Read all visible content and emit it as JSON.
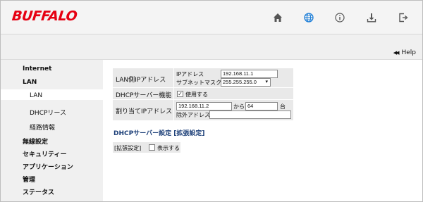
{
  "brand": {
    "logo": "BUFFALO",
    "color": "#e60012"
  },
  "header_icons": [
    {
      "name": "home-icon"
    },
    {
      "name": "globe-icon"
    },
    {
      "name": "info-icon"
    },
    {
      "name": "download-icon"
    },
    {
      "name": "logout-icon"
    }
  ],
  "help": {
    "label": "Help"
  },
  "sidebar": {
    "items": [
      {
        "label": "Internet",
        "level": 1
      },
      {
        "label": "LAN",
        "level": 1
      },
      {
        "label": "LAN",
        "level": 2,
        "active": true
      },
      {
        "label": "DHCPリース",
        "level": 2
      },
      {
        "label": "経路情報",
        "level": 2
      },
      {
        "label": "無線設定",
        "level": 1
      },
      {
        "label": "セキュリティー",
        "level": 1
      },
      {
        "label": "アプリケーション",
        "level": 1
      },
      {
        "label": "管理",
        "level": 1
      },
      {
        "label": "ステータス",
        "level": 1
      }
    ]
  },
  "lan_ip": {
    "label": "LAN側IPアドレス",
    "ip_label": "IPアドレス",
    "ip_value": "192.168.11.1",
    "subnet_label": "サブネットマスク",
    "subnet_value": "255.255.255.0"
  },
  "dhcp_server": {
    "label": "DHCPサーバー機能",
    "checkbox_label": "使用する",
    "checked": true
  },
  "assign_ip": {
    "label": "割り当てIPアドレス",
    "start_value": "192.168.11.2",
    "from_label": "から",
    "count_value": "64",
    "unit_label": "台",
    "exclude_label": "除外アドレス:",
    "exclude_value": ""
  },
  "dhcp_settings": {
    "title": "DHCPサーバー設定",
    "extended_link": "[拡張設定]"
  },
  "extended": {
    "label": "[拡張設定]",
    "checkbox_label": "表示する",
    "checked": false
  }
}
